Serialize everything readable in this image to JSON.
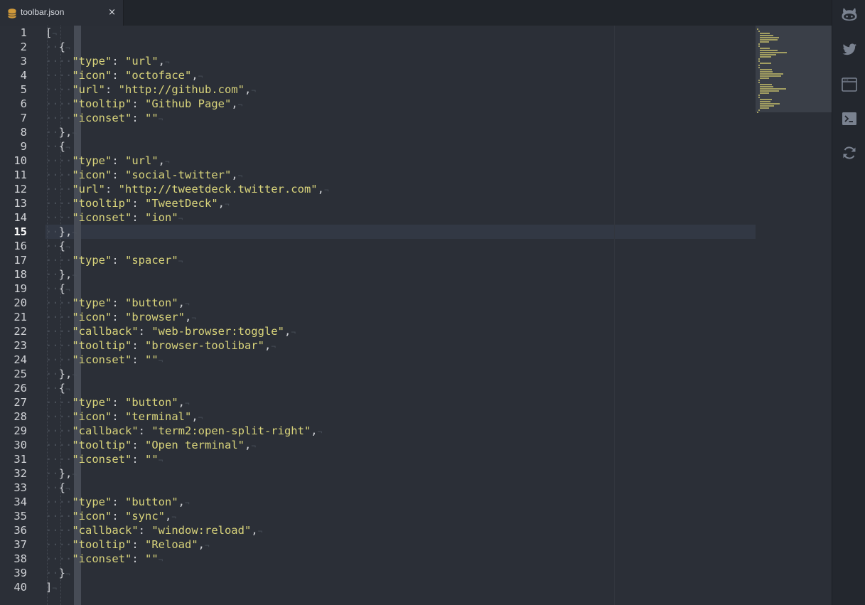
{
  "tab": {
    "title": "toolbar.json",
    "icon": "database-icon",
    "close_glyph": "×"
  },
  "editor": {
    "active_line": 15,
    "lines": [
      "[",
      "  {",
      "    \"type\": \"url\",",
      "    \"icon\": \"octoface\",",
      "    \"url\": \"http://github.com\",",
      "    \"tooltip\": \"Github Page\",",
      "    \"iconset\": \"\"",
      "  },",
      "  {",
      "    \"type\": \"url\",",
      "    \"icon\": \"social-twitter\",",
      "    \"url\": \"http://tweetdeck.twitter.com\",",
      "    \"tooltip\": \"TweetDeck\",",
      "    \"iconset\": \"ion\"",
      "  },",
      "  {",
      "    \"type\": \"spacer\"",
      "  },",
      "  {",
      "    \"type\": \"button\",",
      "    \"icon\": \"browser\",",
      "    \"callback\": \"web-browser:toggle\",",
      "    \"tooltip\": \"browser-toolibar\",",
      "    \"iconset\": \"\"",
      "  },",
      "  {",
      "    \"type\": \"button\",",
      "    \"icon\": \"terminal\",",
      "    \"callback\": \"term2:open-split-right\",",
      "    \"tooltip\": \"Open terminal\",",
      "    \"iconset\": \"\"",
      "  },",
      "  {",
      "    \"type\": \"button\",",
      "    \"icon\": \"sync\",",
      "    \"callback\": \"window:reload\",",
      "    \"tooltip\": \"Reload\",",
      "    \"iconset\": \"\"",
      "  }",
      "]"
    ]
  },
  "toolbar": {
    "buttons": [
      {
        "name": "github-octoface-icon"
      },
      {
        "name": "twitter-icon"
      },
      {
        "name": "browser-icon"
      },
      {
        "name": "terminal-icon"
      },
      {
        "name": "sync-icon"
      }
    ]
  },
  "colors": {
    "string": "#d9d47b",
    "text": "#d0d2d6",
    "background": "#2b2f37",
    "invisibles": "#4a505a"
  }
}
